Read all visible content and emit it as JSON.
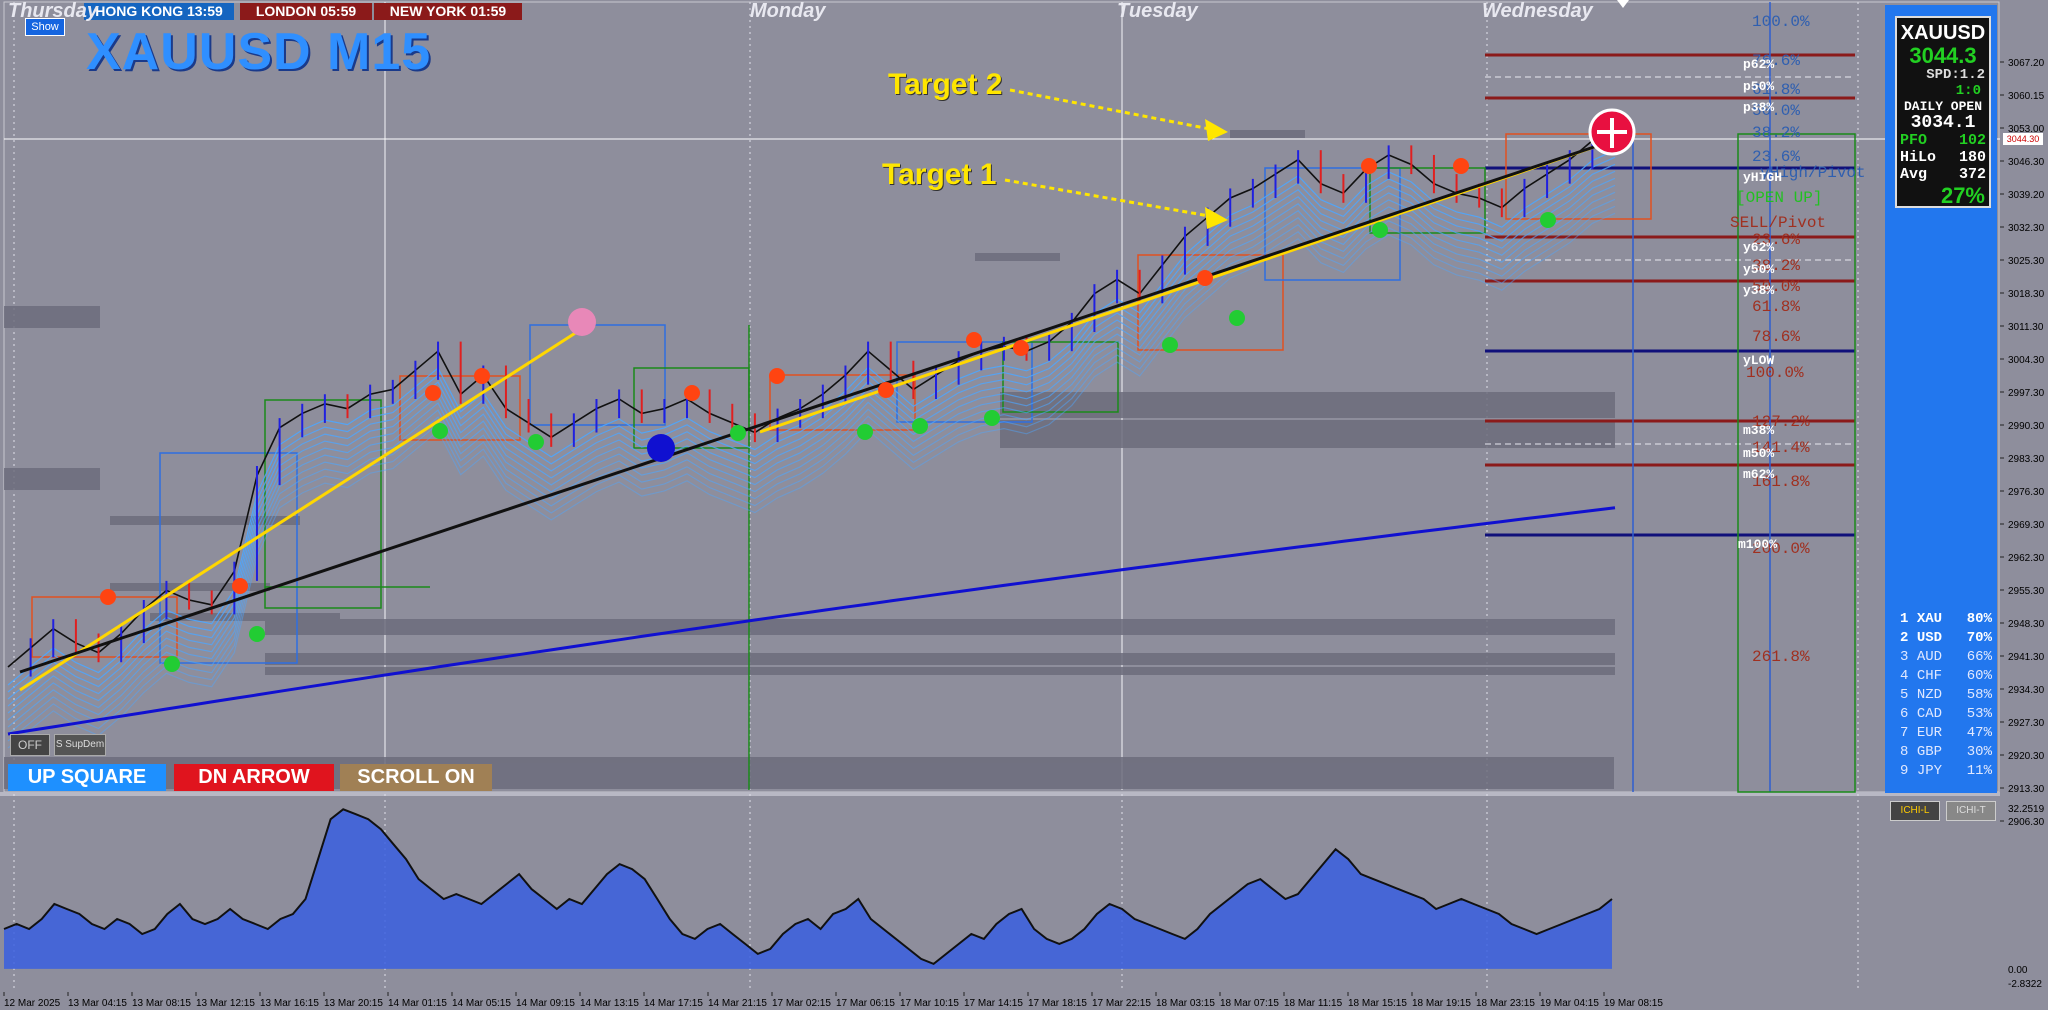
{
  "symbol": {
    "title": "XAUUSD M15",
    "show_label": "Show"
  },
  "sessions": [
    {
      "label": "HONG KONG 13:59",
      "color": "#1565c0"
    },
    {
      "label": "LONDON  05:59",
      "color": "#8b1a1a"
    },
    {
      "label": "NEW YORK  01:59",
      "color": "#8b1a1a"
    }
  ],
  "days": [
    "Thursday",
    "Monday",
    "Tuesday",
    "Wednesday"
  ],
  "annotations": {
    "target2": "Target 2",
    "target1": "Target 1"
  },
  "fib_labels": {
    "blue": [
      "100.0%",
      "76.6%",
      "61.8%",
      "50.0%",
      "38.2%",
      "23.6%",
      "yHigh/Pivot"
    ],
    "red": [
      "23.6%",
      "38.2%",
      "50.0%",
      "61.8%",
      "78.6%",
      "100.0%",
      "127.2%",
      "141.4%",
      "161.8%",
      "200.0%",
      "261.8%"
    ],
    "pivot_up": "[OPEN UP]",
    "sell_pivot": "SELL/Pivot"
  },
  "levels": [
    "p62%",
    "p50%",
    "p38%",
    "yHIGH",
    "y62%",
    "y50%",
    "y38%",
    "yLOW",
    "m38%",
    "m50%",
    "m62%",
    "m100%"
  ],
  "info_panel": {
    "symbol": "XAUUSD",
    "price": "3044.3",
    "spread": "SPD:1.2",
    "ratio": "1:0",
    "daily_open_label": "DAILY OPEN",
    "daily_open": "3034.1",
    "pfo_label": "PFO",
    "pfo": "102",
    "hilo_label": "HiLo",
    "hilo": "180",
    "avg_label": "Avg",
    "avg": "372",
    "percent": "27%"
  },
  "currency_strength": [
    {
      "rank": "1",
      "name": "XAU",
      "value": "80%"
    },
    {
      "rank": "2",
      "name": "USD",
      "value": "70%"
    },
    {
      "rank": "3",
      "name": "AUD",
      "value": "66%"
    },
    {
      "rank": "4",
      "name": "CHF",
      "value": "60%"
    },
    {
      "rank": "5",
      "name": "NZD",
      "value": "58%"
    },
    {
      "rank": "6",
      "name": "CAD",
      "value": "53%"
    },
    {
      "rank": "7",
      "name": "EUR",
      "value": "47%"
    },
    {
      "rank": "8",
      "name": "GBP",
      "value": "30%"
    },
    {
      "rank": "9",
      "name": "JPY",
      "value": "11%"
    }
  ],
  "buttons": {
    "up_square": "UP SQUARE",
    "dn_arrow": "DN ARROW",
    "scroll_on": "SCROLL ON",
    "off": "OFF",
    "supdem": "S SupDem",
    "ichi_l": "ICHI-L",
    "ichi_t": "ICHI-T"
  },
  "price_label": "3044.30",
  "colors": {
    "chart_bg": "#8e8e9c",
    "up_square": "#1e90ff",
    "dn_arrow": "#e0141e",
    "scroll_on": "#a08055",
    "ma": "#1010d0",
    "trend": "#ffd700",
    "band": "#4da6ff"
  },
  "chart_data": {
    "type": "line",
    "title": "XAUUSD M15",
    "yticks": [
      "3067.20",
      "3060.15",
      "3053.00",
      "3046.30",
      "3039.20",
      "3032.30",
      "3025.30",
      "3018.30",
      "3011.30",
      "3004.30",
      "2997.30",
      "2990.30",
      "2983.30",
      "2976.30",
      "2969.30",
      "2962.30",
      "2955.30",
      "2948.30",
      "2941.30",
      "2934.30",
      "2927.30",
      "2920.30",
      "2913.30",
      "2906.30"
    ],
    "ylim": [
      2906.3,
      3067.2
    ],
    "x": [
      "12 Mar 2025",
      "13 Mar 04:15",
      "13 Mar 08:15",
      "13 Mar 12:15",
      "13 Mar 16:15",
      "13 Mar 20:15",
      "14 Mar 01:15",
      "14 Mar 05:15",
      "14 Mar 09:15",
      "14 Mar 13:15",
      "14 Mar 17:15",
      "14 Mar 21:15",
      "17 Mar 02:15",
      "17 Mar 06:15",
      "17 Mar 10:15",
      "17 Mar 14:15",
      "17 Mar 18:15",
      "17 Mar 22:15",
      "18 Mar 03:15",
      "18 Mar 07:15",
      "18 Mar 11:15",
      "18 Mar 15:15",
      "18 Mar 19:15",
      "18 Mar 23:15",
      "19 Mar 04:15",
      "19 Mar 08:15"
    ],
    "series": [
      {
        "values": [
          2932,
          2936,
          2940,
          2937,
          2935,
          2939,
          2944,
          2948,
          2946,
          2945,
          2952,
          2972,
          2982,
          2985,
          2987,
          2986,
          2989,
          2990,
          2994,
          2998,
          2989,
          2993,
          2986,
          2983,
          2980,
          2983,
          2986,
          2988,
          2985,
          2986,
          2988,
          2985,
          2983,
          2981,
          2984,
          2986,
          2989,
          2993,
          2998,
          2994,
          2990,
          2993,
          2996,
          2998,
          2999,
          2998,
          3000,
          3004,
          3010,
          3013,
          3010,
          3016,
          3022,
          3026,
          3030,
          3032,
          3035,
          3038,
          3033,
          3031,
          3036,
          3039,
          3037,
          3033,
          3031,
          3030,
          3028,
          3032,
          3035,
          3038,
          3042,
          3044
        ]
      }
    ],
    "oscillator": {
      "ylim": [
        -2.8322,
        32.2519
      ],
      "yticks": [
        "32.2519",
        "0.00",
        "-2.8322"
      ],
      "values": [
        8,
        9,
        8,
        10,
        13,
        12,
        11,
        9,
        8,
        10,
        9,
        7,
        8,
        11,
        13,
        10,
        9,
        10,
        12,
        10,
        9,
        8,
        10,
        11,
        14,
        22,
        30,
        32,
        31,
        30,
        28,
        25,
        22,
        18,
        16,
        14,
        15,
        14,
        13,
        15,
        17,
        19,
        16,
        14,
        12,
        14,
        13,
        16,
        19,
        21,
        20,
        18,
        14,
        10,
        7,
        6,
        8,
        9,
        7,
        5,
        3,
        4,
        7,
        9,
        10,
        8,
        11,
        12,
        14,
        10,
        8,
        6,
        4,
        2,
        1,
        3,
        5,
        7,
        6,
        9,
        11,
        12,
        8,
        6,
        5,
        6,
        8,
        11,
        13,
        12,
        10,
        9,
        8,
        7,
        6,
        8,
        11,
        13,
        15,
        17,
        18,
        16,
        14,
        15,
        18,
        21,
        24,
        22,
        19,
        18,
        17,
        16,
        15,
        14,
        12,
        13,
        14,
        13,
        12,
        11,
        9,
        8,
        7,
        8,
        9,
        10,
        11,
        12,
        14
      ]
    }
  }
}
